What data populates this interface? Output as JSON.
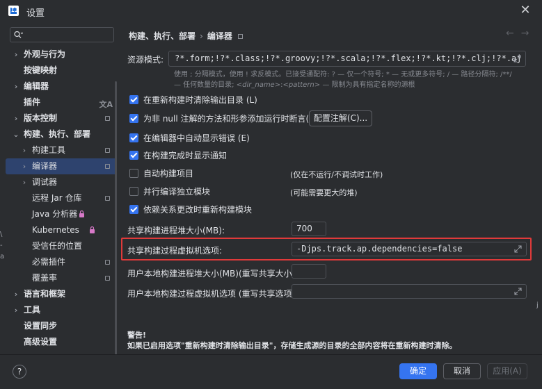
{
  "window": {
    "title": "设置"
  },
  "sidebar": {
    "search_placeholder": "",
    "items": [
      {
        "label": "外观与行为",
        "chevron": "›",
        "bold": true,
        "indent": 0
      },
      {
        "label": "按键映射",
        "chevron": "",
        "bold": true,
        "indent": 0
      },
      {
        "label": "编辑器",
        "chevron": "›",
        "bold": true,
        "indent": 0
      },
      {
        "label": "插件",
        "chevron": "",
        "bold": true,
        "indent": 0,
        "icon": "translate-icon"
      },
      {
        "label": "版本控制",
        "chevron": "›",
        "bold": true,
        "indent": 0,
        "icon": "project-icon"
      },
      {
        "label": "构建、执行、部署",
        "chevron": "⌄",
        "bold": true,
        "indent": 0
      },
      {
        "label": "构建工具",
        "chevron": "›",
        "bold": false,
        "indent": 1,
        "icon": "project-icon"
      },
      {
        "label": "编译器",
        "chevron": "›",
        "bold": false,
        "indent": 1,
        "icon": "project-icon",
        "selected": true
      },
      {
        "label": "调试器",
        "chevron": "›",
        "bold": false,
        "indent": 1
      },
      {
        "label": "远程 Jar 仓库",
        "chevron": "",
        "bold": false,
        "indent": 1,
        "icon": "project-icon"
      },
      {
        "label": "Java 分析器",
        "chevron": "",
        "bold": false,
        "indent": 1,
        "icon": "lock-icon"
      },
      {
        "label": "Kubernetes",
        "chevron": "",
        "bold": false,
        "indent": 1,
        "icon": "lock-icon"
      },
      {
        "label": "受信任的位置",
        "chevron": "",
        "bold": false,
        "indent": 1
      },
      {
        "label": "必需插件",
        "chevron": "",
        "bold": false,
        "indent": 1,
        "icon": "project-icon"
      },
      {
        "label": "覆盖率",
        "chevron": "",
        "bold": false,
        "indent": 1,
        "icon": "project-icon"
      },
      {
        "label": "语言和框架",
        "chevron": "›",
        "bold": true,
        "indent": 0
      },
      {
        "label": "工具",
        "chevron": "›",
        "bold": true,
        "indent": 0
      },
      {
        "label": "设置同步",
        "chevron": "",
        "bold": true,
        "indent": 0
      },
      {
        "label": "高级设置",
        "chevron": "",
        "bold": true,
        "indent": 0
      }
    ]
  },
  "breadcrumb": {
    "parent": "构建、执行、部署",
    "separator": "›",
    "current": "编译器"
  },
  "resource": {
    "label": "资源模式:",
    "value": "?*.form;!?*.class;!?*.groovy;!?*.scala;!?*.flex;!?*.kt;!?*.clj;!?*.aj",
    "hint_line1": "使用 ; 分隔模式，使用 ! 求反模式。已接受通配符: ? — 仅一个符号; * — 无或更多符号; / — 路径分隔符; /**/",
    "hint_line2_prefix": "— 任何数量的目录; ",
    "hint_line2_dir": "<dir_name>",
    "hint_line2_colon": ":",
    "hint_line2_pattern": "<pattern>",
    "hint_line2_suffix": " — 限制为具有指定名称的源根"
  },
  "options": {
    "clear_output": "在重新构建时清除输出目录 (L)",
    "add_runtime_assert": "为非 null 注解的方法和形参添加运行时断言(A)",
    "configure_annotations": "配置注解(C)...",
    "show_errors": "在编辑器中自动显示错误 (E)",
    "notify_done": "在构建完成时显示通知",
    "auto_build": "自动构建项目",
    "auto_build_note": "(仅在不运行/不调试时工作)",
    "parallel": "并行编译独立模块",
    "parallel_note": "(可能需要更大的堆)",
    "rebuild_deps": "依赖关系更改时重新构建模块"
  },
  "fields": {
    "shared_heap_label": "共享构建进程堆大小(MB):",
    "shared_heap_value": "700",
    "shared_vm_label": "共享构建过程虚拟机选项:",
    "shared_vm_value": "-Djps.track.ap.dependencies=false",
    "local_heap_label": "用户本地构建进程堆大小(MB)(重写共享大小):",
    "local_heap_value": "",
    "local_vm_label": "用户本地构建过程虚拟机选项 (重写共享选项):",
    "local_vm_value": ""
  },
  "warning": {
    "title": "警告!",
    "body": "如果已启用选项\"重新构建时清除输出目录\"，存储生成源的目录的全部内容将在重新构建时清除。"
  },
  "footer": {
    "help": "?",
    "ok": "确定",
    "cancel": "取消",
    "apply": "应用(A)"
  },
  "edge_text": {
    "left": "\\ -a",
    "right": "j"
  },
  "colors": {
    "accent": "#3574f0",
    "highlight": "#e03a3a",
    "background": "#2b2d30",
    "selected": "#2e436e"
  }
}
